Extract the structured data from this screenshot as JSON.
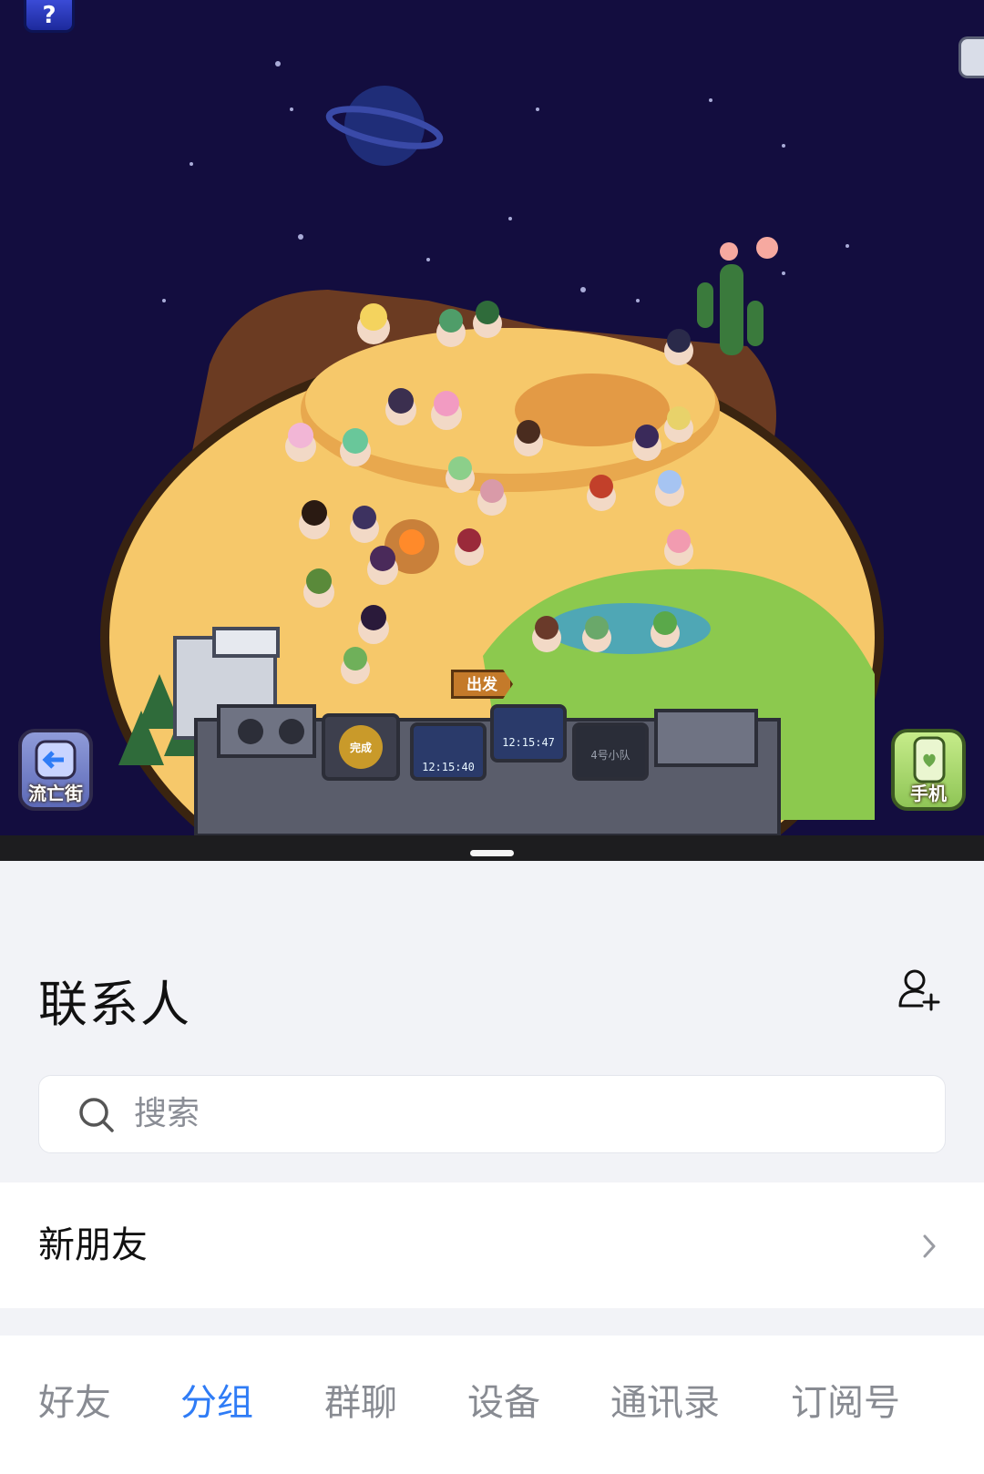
{
  "game": {
    "help_label": "?",
    "exile_street_label": "流亡街",
    "phone_label": "手机",
    "depart_label": "出发",
    "console": {
      "done_label": "完成",
      "timer_1": "12:15:40",
      "timer_2": "12:15:47",
      "team_label": "4号小队"
    }
  },
  "contacts": {
    "title": "联系人",
    "search": {
      "placeholder": "搜索"
    },
    "new_friends_label": "新朋友",
    "tabs": [
      {
        "label": "好友",
        "active": false
      },
      {
        "label": "分组",
        "active": true
      },
      {
        "label": "群聊",
        "active": false
      },
      {
        "label": "设备",
        "active": false
      },
      {
        "label": "通讯录",
        "active": false
      },
      {
        "label": "订阅号",
        "active": false
      }
    ]
  },
  "colors": {
    "accent": "#2f7cf6",
    "space_bg": "#130d3f",
    "sand": "#f6c86a",
    "grass": "#8cc94e"
  }
}
